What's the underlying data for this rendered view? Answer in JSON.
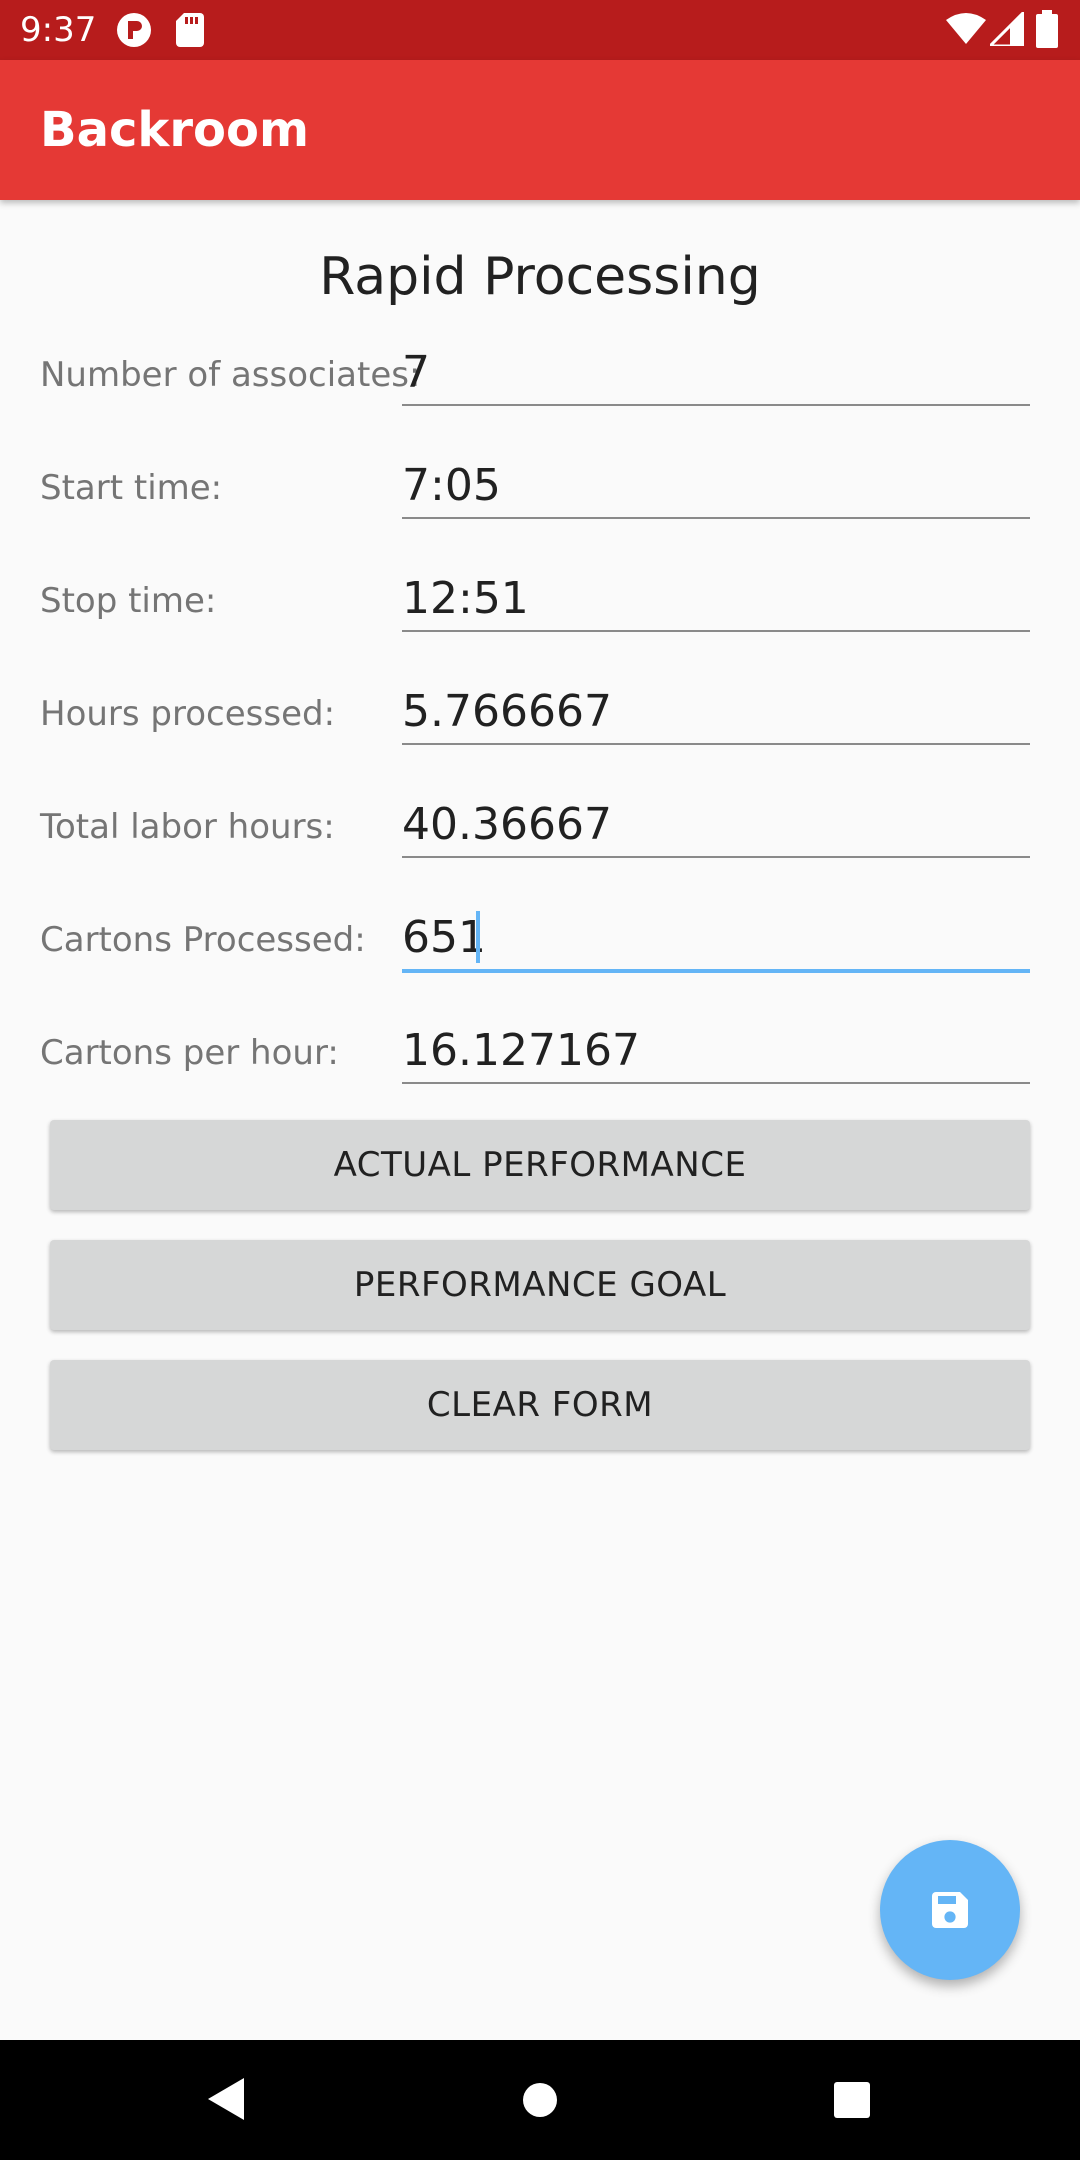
{
  "status_bar": {
    "time": "9:37",
    "left_icons": [
      "app-notification-icon",
      "sd-card-icon"
    ],
    "right_icons": [
      "wifi-icon",
      "cell-signal-icon",
      "battery-icon"
    ],
    "background": "#b71c1c"
  },
  "app_bar": {
    "title": "Backroom",
    "background": "#e53935"
  },
  "form": {
    "title": "Rapid Processing",
    "fields": [
      {
        "label": "Number of associates:",
        "value": "7"
      },
      {
        "label": "Start time:",
        "value": "7:05"
      },
      {
        "label": "Stop time:",
        "value": "12:51"
      },
      {
        "label": "Hours processed:",
        "value": "5.766667"
      },
      {
        "label": "Total labor hours:",
        "value": "40.36667"
      },
      {
        "label": "Cartons Processed:",
        "value": "651"
      },
      {
        "label": "Cartons per hour:",
        "value": "16.127167"
      }
    ],
    "active_field": "Cartons Processed:",
    "accent_color": "#64b5f6"
  },
  "buttons": {
    "actual_performance": "ACTUAL PERFORMANCE",
    "performance_goal": "PERFORMANCE GOAL",
    "clear_form": "CLEAR FORM"
  },
  "fab": {
    "icon": "save-icon",
    "color": "#64b5f6"
  },
  "nav_bar": {
    "icons": [
      "back-icon",
      "home-icon",
      "recents-icon"
    ]
  }
}
